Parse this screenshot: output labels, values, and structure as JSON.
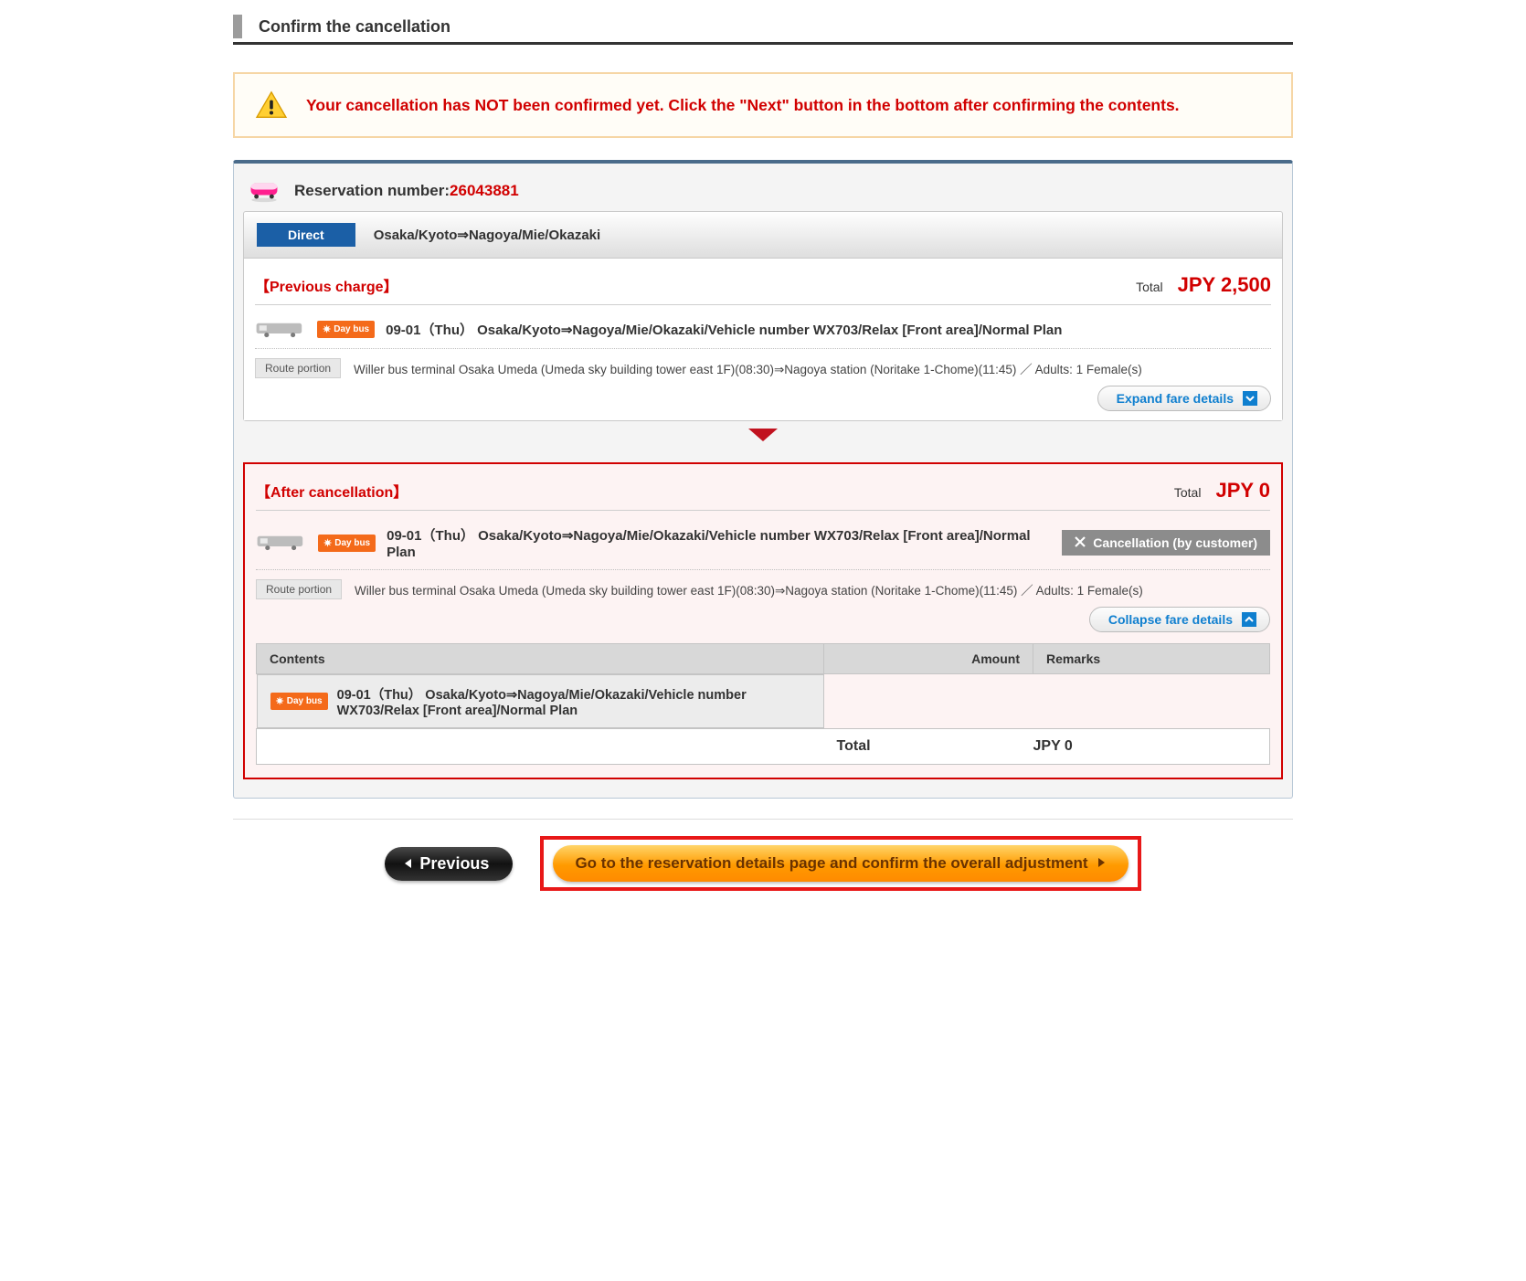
{
  "page_title": "Confirm the cancellation",
  "warning": "Your cancellation has NOT been confirmed yet. Click the \"Next\" button in the bottom after confirming the contents.",
  "reservation": {
    "label": "Reservation number: ",
    "number": "26043881",
    "direct_badge": "Direct",
    "route_name": "Osaka/Kyoto⇒Nagoya/Mie/Okazaki"
  },
  "previous": {
    "heading": "【Previous charge】",
    "total_label": "Total",
    "total_value": "JPY 2,500",
    "day_bus_label": "Day bus",
    "trip_desc": "09-01（Thu）  Osaka/Kyoto⇒Nagoya/Mie/Okazaki/Vehicle number WX703/Relax [Front area]/Normal Plan",
    "route_portion_badge": "Route portion",
    "portion_text": "Willer bus terminal Osaka Umeda (Umeda sky building tower east 1F)(08:30)⇒Nagoya station (Noritake 1-Chome)(11:45) ／ Adults: 1 Female(s)",
    "toggle": "Expand fare details"
  },
  "after": {
    "heading": "【After cancellation】",
    "total_label": "Total",
    "total_value": "JPY 0",
    "day_bus_label": "Day bus",
    "trip_desc": "09-01（Thu）  Osaka/Kyoto⇒Nagoya/Mie/Okazaki/Vehicle number WX703/Relax [Front area]/Normal Plan",
    "cancel_badge": "Cancellation (by customer)",
    "route_portion_badge": "Route portion",
    "portion_text": "Willer bus terminal Osaka Umeda (Umeda sky building tower east 1F)(08:30)⇒Nagoya station (Noritake 1-Chome)(11:45) ／ Adults: 1 Female(s)",
    "toggle": "Collapse fare details"
  },
  "fare_table": {
    "headers": {
      "contents": "Contents",
      "amount": "Amount",
      "remarks": "Remarks"
    },
    "row_day_bus": "Day bus",
    "row_contents": "09-01（Thu）  Osaka/Kyoto⇒Nagoya/Mie/Okazaki/Vehicle number WX703/Relax [Front area]/Normal Plan",
    "total_label": "Total",
    "total_value": "JPY 0"
  },
  "buttons": {
    "previous": "Previous",
    "next": "Go to the reservation details page and confirm the overall adjustment"
  }
}
